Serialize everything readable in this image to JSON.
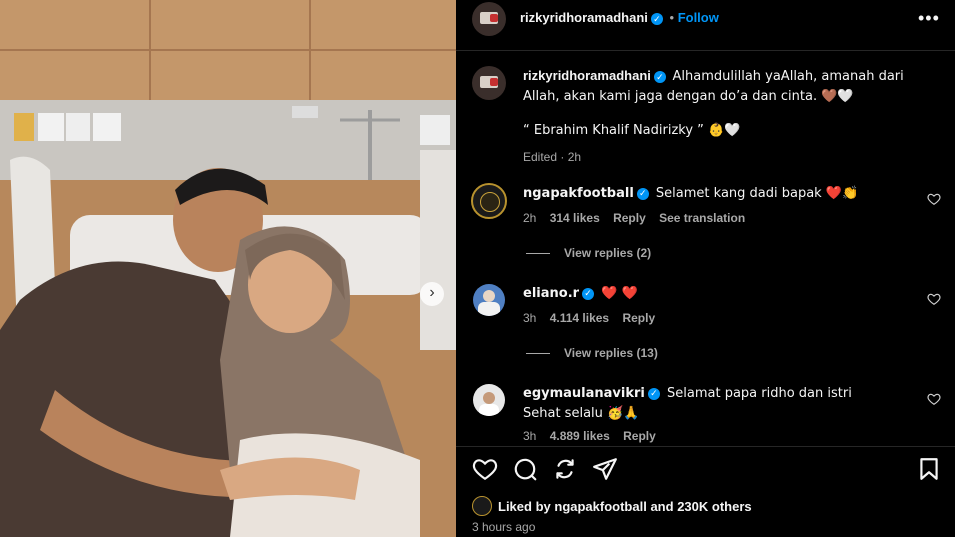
{
  "header": {
    "username": "rizkyridhoramadhani",
    "dot": "•",
    "follow_label": "Follow",
    "more_icon": "more-horizontal-icon"
  },
  "caption": {
    "username": "rizkyridhoramadhani",
    "text_line1": "Alhamdulillah yaAllah, amanah dari",
    "text_line2": "Allah, akan kami jaga dengan do’a dan cinta. 🤎🤍",
    "text_line3": "“ Ebrahim Khalif Nadirizky ” 👶🤍",
    "edited": "Edited · 2h"
  },
  "comments": [
    {
      "username": "ngapakfootball",
      "text": "Selamet kang dadi bapak ❤️👏",
      "time": "2h",
      "likes": "314 likes",
      "reply": "Reply",
      "translate": "See translation",
      "view_replies": "View replies (2)"
    },
    {
      "username": "eliano.r",
      "text": "❤️ ❤️",
      "time": "3h",
      "likes": "4.114 likes",
      "reply": "Reply",
      "view_replies": "View replies (13)"
    },
    {
      "username": "egymaulanavikri",
      "text": "Selamat papa ridho dan istri",
      "text2": "Sehat selalu 🥳🙏",
      "time": "3h",
      "likes": "4.889 likes",
      "reply": "Reply"
    }
  ],
  "footer": {
    "liked_prefix": "Liked by",
    "liked_user": "ngapakfootball",
    "liked_suffix": "and",
    "liked_count": "230K others",
    "timestamp": "3 hours ago"
  },
  "colors": {
    "accent": "#0095f6",
    "muted": "#a8a8a8",
    "background": "#000000"
  }
}
